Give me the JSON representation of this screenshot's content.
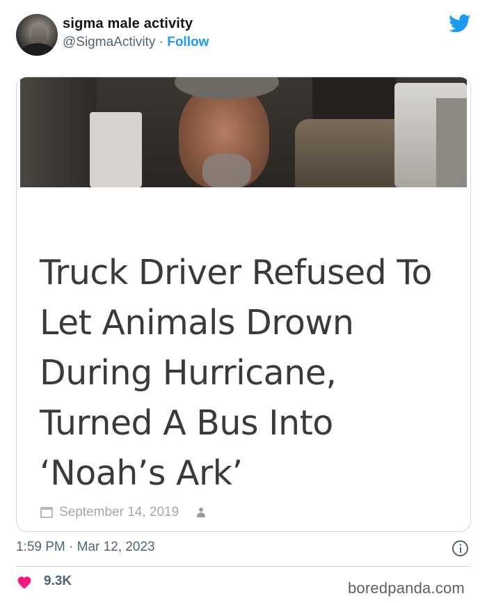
{
  "author": {
    "display_name": "sigma male activity",
    "handle": "@SigmaActivity",
    "separator": " · ",
    "follow_label": "Follow"
  },
  "card": {
    "headline": "Truck Driver Refused To Let Animals Drown During Hurricane, Turned A Bus Into ‘Noah’s Ark’",
    "date": "September 14, 2019"
  },
  "footer": {
    "timestamp": "1:59 PM · Mar 12, 2023",
    "like_count": "9.3K",
    "watermark": "boredpanda.com"
  },
  "icons": {
    "brand": "twitter-bird-icon",
    "like": "heart-icon",
    "info": "info-icon",
    "calendar": "calendar-icon",
    "author": "user-icon"
  },
  "colors": {
    "accent": "#1d9bf0",
    "like": "#f91880",
    "muted_text": "#536471",
    "headline_text": "#3a3a3a"
  }
}
